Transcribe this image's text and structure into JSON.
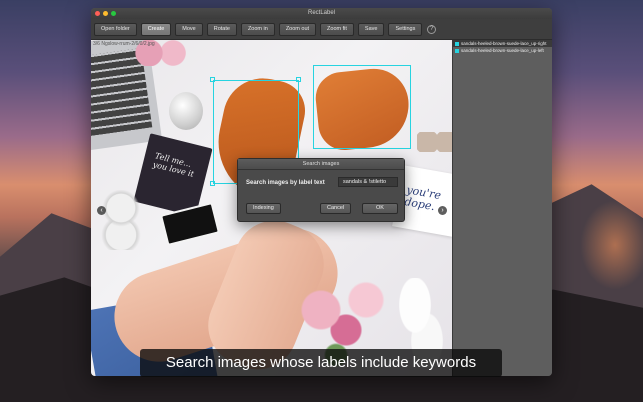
{
  "window": {
    "title": "RectLabel"
  },
  "toolbar": {
    "buttons": [
      {
        "label": "Open folder"
      },
      {
        "label": "Create"
      },
      {
        "label": "Move"
      },
      {
        "label": "Rotate"
      },
      {
        "label": "Zoom in"
      },
      {
        "label": "Zoom out"
      },
      {
        "label": "Zoom fit"
      },
      {
        "label": "Save"
      },
      {
        "label": "Settings"
      }
    ],
    "help_label": "?"
  },
  "canvas": {
    "filename": "3/6 Ngslow-rrum-2/6/0/2.jpg",
    "book_text": "Tell me... you love it",
    "card_text": "you're dope.",
    "prev_arrow": "‹",
    "next_arrow": "›"
  },
  "labels": [
    {
      "text": "sandals-heeled-brown-suede-lace_up-right",
      "color": "#27d3e0",
      "selected": true
    },
    {
      "text": "sandals-heeled-brown-suede-lace_up-left",
      "color": "#27d3e0",
      "selected": false
    }
  ],
  "dialog": {
    "title": "Search images",
    "label": "Search images by label text",
    "input_value": "sandals & !stiletto",
    "indexing_label": "Indexing",
    "cancel_label": "Cancel",
    "ok_label": "OK"
  },
  "caption": {
    "text": "Search images whose labels include keywords"
  },
  "colors": {
    "bbox": "#27d3e0"
  }
}
